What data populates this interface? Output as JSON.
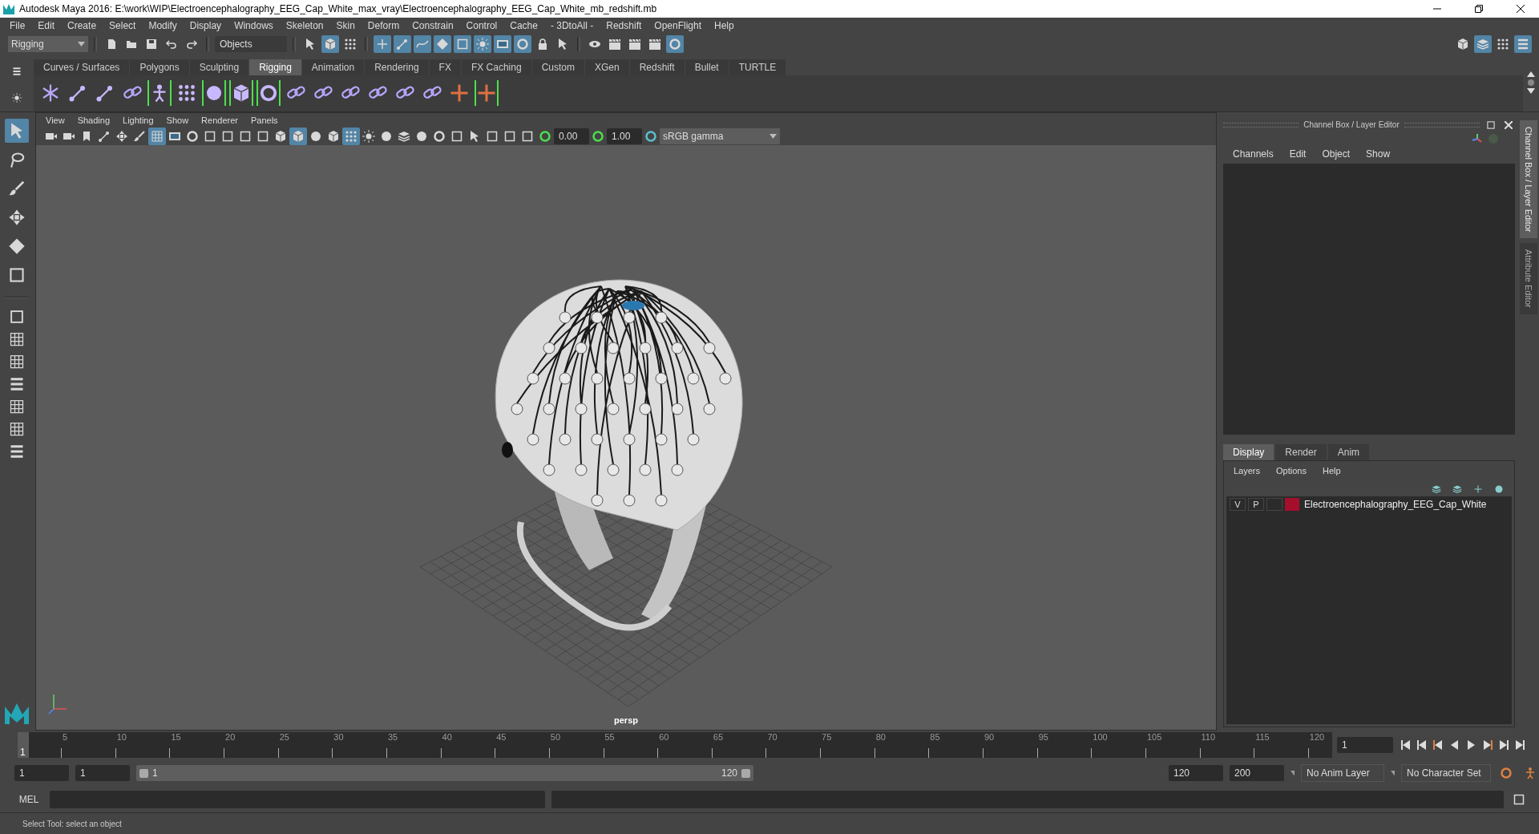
{
  "window": {
    "title": "Autodesk Maya 2016: E:\\work\\WIP\\Electroencephalography_EEG_Cap_White_max_vray\\Electroencephalography_EEG_Cap_White_mb_redshift.mb"
  },
  "menu_bar": [
    "File",
    "Edit",
    "Create",
    "Select",
    "Modify",
    "Display",
    "Windows",
    "Skeleton",
    "Skin",
    "Deform",
    "Constrain",
    "Control",
    "Cache",
    "- 3DtoAll -",
    "Redshift",
    "OpenFlight",
    "Help"
  ],
  "status_line": {
    "mode": "Rigging",
    "selection_mode": "Objects",
    "file_tools": [
      {
        "kind": "page"
      },
      {
        "kind": "folder"
      },
      {
        "kind": "disk"
      },
      {
        "kind": "undo-arrow"
      },
      {
        "kind": "redo-arrow"
      }
    ],
    "select_tools": [
      {
        "kind": "cursor",
        "on": false
      },
      {
        "kind": "cube",
        "on": true
      },
      {
        "kind": "dots",
        "on": false
      }
    ],
    "snap_tools": [
      {
        "kind": "plus",
        "on": true
      },
      {
        "kind": "bone",
        "on": true
      },
      {
        "kind": "curve",
        "on": true
      },
      {
        "kind": "diamond",
        "on": true
      },
      {
        "kind": "square-frame",
        "on": true
      },
      {
        "kind": "sun",
        "on": true
      },
      {
        "kind": "film",
        "on": true
      },
      {
        "kind": "ring",
        "on": true
      },
      {
        "kind": "lock",
        "on": false
      },
      {
        "kind": "cursor",
        "on": false
      }
    ],
    "render_tools": [
      {
        "kind": "eye",
        "on": false
      },
      {
        "kind": "clapper",
        "on": false
      },
      {
        "kind": "clapper",
        "on": false
      },
      {
        "kind": "clapper",
        "on": false
      },
      {
        "kind": "ring",
        "on": true
      }
    ]
  },
  "workspace_tools": [
    {
      "kind": "cube",
      "on": false
    },
    {
      "kind": "layers",
      "on": true
    },
    {
      "kind": "dots",
      "on": false
    },
    {
      "kind": "stack",
      "on": true
    }
  ],
  "shelf": {
    "tabs": [
      {
        "label": "Curves / Surfaces",
        "selected": false
      },
      {
        "label": "Polygons",
        "selected": false
      },
      {
        "label": "Sculpting",
        "selected": false
      },
      {
        "label": "Rigging",
        "selected": true
      },
      {
        "label": "Animation",
        "selected": false
      },
      {
        "label": "Rendering",
        "selected": false
      },
      {
        "label": "FX",
        "selected": false
      },
      {
        "label": "FX Caching",
        "selected": false
      },
      {
        "label": "Custom",
        "selected": false
      },
      {
        "label": "XGen",
        "selected": false
      },
      {
        "label": "Redshift",
        "selected": false
      },
      {
        "label": "Bullet",
        "selected": false
      },
      {
        "label": "TURTLE",
        "selected": false
      }
    ],
    "tools": [
      {
        "kind": "asterisk",
        "framed": false
      },
      {
        "kind": "bone",
        "framed": false
      },
      {
        "kind": "bone",
        "framed": false
      },
      {
        "kind": "chain",
        "framed": false
      },
      {
        "kind": "figure",
        "framed": true
      },
      {
        "kind": "dots",
        "framed": false
      },
      {
        "kind": "sphere",
        "framed": true
      },
      {
        "kind": "cube",
        "framed": true
      },
      {
        "kind": "ring",
        "framed": true
      },
      {
        "kind": "chain",
        "framed": false
      },
      {
        "kind": "chain",
        "framed": false
      },
      {
        "kind": "chain",
        "framed": false
      },
      {
        "kind": "chain",
        "framed": false
      },
      {
        "kind": "chain",
        "framed": false
      },
      {
        "kind": "chain",
        "framed": false
      },
      {
        "kind": "cross",
        "framed": false
      },
      {
        "kind": "cross",
        "framed": true
      }
    ]
  },
  "toolbox": [
    {
      "kind": "cursor",
      "selected": true
    },
    {
      "kind": "lasso",
      "selected": false
    },
    {
      "kind": "brush",
      "selected": false
    },
    {
      "kind": "move",
      "selected": false
    },
    {
      "kind": "diamond",
      "selected": false
    },
    {
      "kind": "square-frame",
      "selected": false
    }
  ],
  "viewport": {
    "menu": [
      "View",
      "Shading",
      "Lighting",
      "Show",
      "Renderer",
      "Panels"
    ],
    "tools": [
      {
        "kind": "camera",
        "on": false
      },
      {
        "kind": "camera",
        "on": false
      },
      {
        "kind": "bookmark",
        "on": false
      },
      {
        "kind": "bone",
        "on": false
      },
      {
        "kind": "move",
        "on": false
      },
      {
        "kind": "brush",
        "on": false
      },
      {
        "kind": "grid",
        "on": true
      },
      {
        "kind": "film",
        "on": false
      },
      {
        "kind": "ring",
        "on": false
      },
      {
        "kind": "square-frame",
        "on": false
      },
      {
        "kind": "square-frame",
        "on": false
      },
      {
        "kind": "square-frame",
        "on": false
      },
      {
        "kind": "square-frame",
        "on": false
      },
      {
        "kind": "cube",
        "on": false
      },
      {
        "kind": "cube",
        "on": true
      },
      {
        "kind": "sphere",
        "on": false
      },
      {
        "kind": "cube",
        "on": false
      },
      {
        "kind": "dots",
        "on": true
      },
      {
        "kind": "sun",
        "on": false
      },
      {
        "kind": "sphere",
        "on": false
      },
      {
        "kind": "layers",
        "on": false
      },
      {
        "kind": "sphere",
        "on": false
      },
      {
        "kind": "ring",
        "on": false
      },
      {
        "kind": "square-frame",
        "on": false
      },
      {
        "kind": "cursor",
        "on": false
      },
      {
        "kind": "square-frame",
        "on": false
      },
      {
        "kind": "square-frame",
        "on": false
      },
      {
        "kind": "square-frame",
        "on": false
      }
    ],
    "exposure": "0.00",
    "gamma": "1.00",
    "color_space": "sRGB gamma",
    "camera": "persp"
  },
  "channel_box": {
    "title": "Channel Box / Layer Editor",
    "menu": [
      "Channels",
      "Edit",
      "Object",
      "Show"
    ]
  },
  "layer_editor": {
    "tabs": [
      {
        "label": "Display",
        "selected": true
      },
      {
        "label": "Render",
        "selected": false
      },
      {
        "label": "Anim",
        "selected": false
      }
    ],
    "menu": [
      "Layers",
      "Options",
      "Help"
    ],
    "layers": [
      {
        "visible": "V",
        "playback": "P",
        "color": "#a50f2c",
        "name": "Electroencephalography_EEG_Cap_White"
      }
    ]
  },
  "side_tabs": [
    {
      "label": "Channel Box / Layer Editor",
      "selected": true
    },
    {
      "label": "Attribute Editor",
      "selected": false
    }
  ],
  "timeline": {
    "level": 0,
    "ticks": [
      "5",
      "10",
      "15",
      "20",
      "25",
      "30",
      "35",
      "40",
      "45",
      "50",
      "55",
      "60",
      "65",
      "70",
      "75",
      "80",
      "85",
      "90",
      "95",
      "100",
      "105",
      "110",
      "115",
      "120"
    ],
    "current_frame": "1",
    "frame_field": "1"
  },
  "range": {
    "level": 1,
    "start": "1",
    "playback_start": "1",
    "slider_start": "1",
    "slider_end": "120",
    "playback_end": "120",
    "end": "200",
    "anim_layer": "No Anim Layer",
    "character_set": "No Character Set"
  },
  "command_line": {
    "label": "MEL"
  },
  "help_line": "Select Tool: select an object"
}
